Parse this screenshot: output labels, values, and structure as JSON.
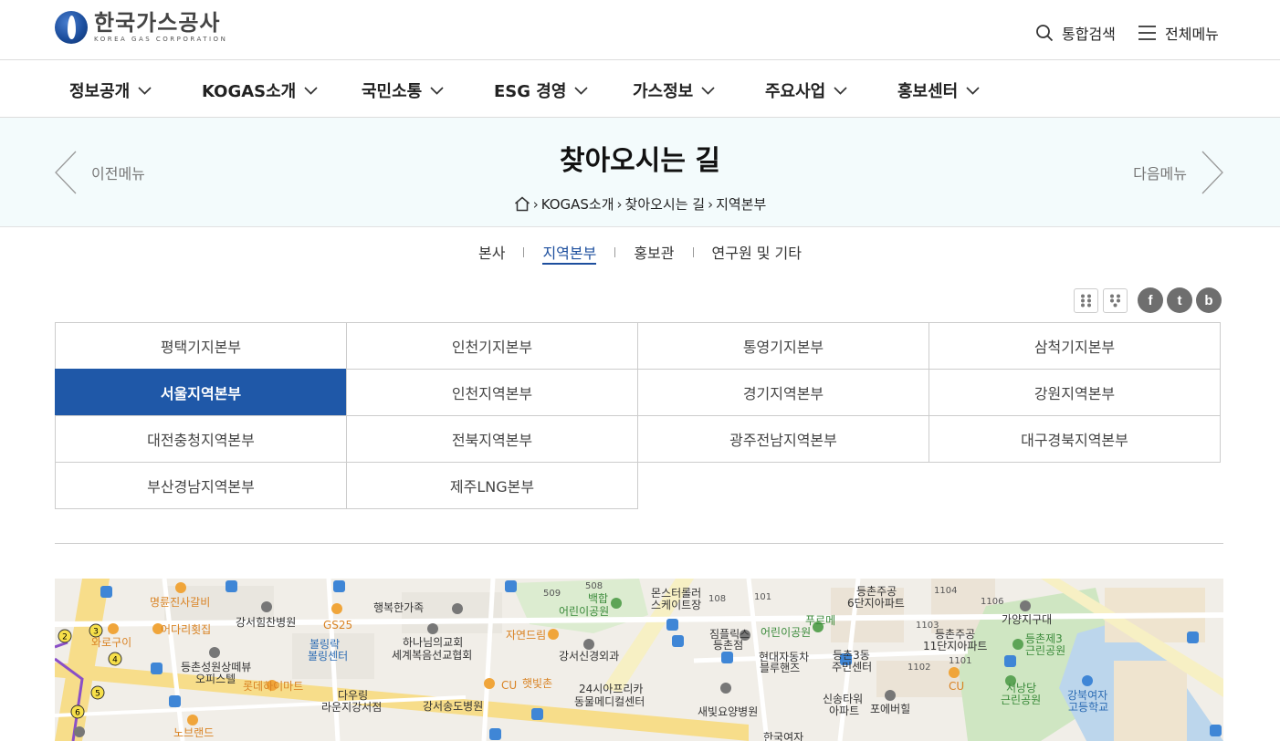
{
  "header": {
    "logo_ko": "한국가스공사",
    "logo_en": "KOREA GAS CORPORATION",
    "search_label": "통합검색",
    "menu_label": "전체메뉴"
  },
  "gnb": [
    {
      "label": "정보공개"
    },
    {
      "label": "KOGAS소개"
    },
    {
      "label": "국민소통"
    },
    {
      "label": "ESG 경영"
    },
    {
      "label": "가스정보"
    },
    {
      "label": "주요사업"
    },
    {
      "label": "홍보센터"
    }
  ],
  "subvisual": {
    "title": "찾아오시는 길",
    "prev_label": "이전메뉴",
    "next_label": "다음메뉴",
    "breadcrumb": [
      "KOGAS소개",
      "찾아오시는 길",
      "지역본부"
    ]
  },
  "subtabs": [
    {
      "label": "본사",
      "active": false
    },
    {
      "label": "지역본부",
      "active": true
    },
    {
      "label": "홍보관",
      "active": false
    },
    {
      "label": "연구원 및 기타",
      "active": false
    }
  ],
  "regions": [
    {
      "label": "평택기지본부",
      "active": false
    },
    {
      "label": "인천기지본부",
      "active": false
    },
    {
      "label": "통영기지본부",
      "active": false
    },
    {
      "label": "삼척기지본부",
      "active": false
    },
    {
      "label": "서울지역본부",
      "active": true
    },
    {
      "label": "인천지역본부",
      "active": false
    },
    {
      "label": "경기지역본부",
      "active": false
    },
    {
      "label": "강원지역본부",
      "active": false
    },
    {
      "label": "대전충청지역본부",
      "active": false
    },
    {
      "label": "전북지역본부",
      "active": false
    },
    {
      "label": "광주전남지역본부",
      "active": false
    },
    {
      "label": "대구경북지역본부",
      "active": false
    },
    {
      "label": "부산경남지역본부",
      "active": false
    },
    {
      "label": "제주LNG본부",
      "active": false
    }
  ],
  "sns": {
    "facebook": "f",
    "twitter": "t",
    "blog": "b"
  },
  "map_labels": [
    {
      "text": "명륜진사갈비",
      "style": "orange"
    },
    {
      "text": "강서힘찬병원",
      "style": ""
    },
    {
      "text": "GS25",
      "style": "orange"
    },
    {
      "text": "행복한가족",
      "style": ""
    },
    {
      "text": "어다리횟집",
      "style": "orange"
    },
    {
      "text": "와로구이",
      "style": "orange"
    },
    {
      "text": "하나님의교회",
      "style": ""
    },
    {
      "text": "세계복음선교협회",
      "style": ""
    },
    {
      "text": "볼링락",
      "style": "blue"
    },
    {
      "text": "볼링센터",
      "style": "blue"
    },
    {
      "text": "등촌성원상떼뷰",
      "style": ""
    },
    {
      "text": "오피스텔",
      "style": ""
    },
    {
      "text": "롯데하이마트",
      "style": "orange"
    },
    {
      "text": "다우링",
      "style": ""
    },
    {
      "text": "라운지강서점",
      "style": ""
    },
    {
      "text": "강서송도병원",
      "style": ""
    },
    {
      "text": "자연드림",
      "style": "orange"
    },
    {
      "text": "강서신경외과",
      "style": ""
    },
    {
      "text": "CU",
      "style": "orange"
    },
    {
      "text": "햇빛촌",
      "style": "orange"
    },
    {
      "text": "24시아프리카",
      "style": ""
    },
    {
      "text": "동물메디컬센터",
      "style": ""
    },
    {
      "text": "508",
      "style": "small"
    },
    {
      "text": "509",
      "style": "small"
    },
    {
      "text": "백합",
      "style": "green"
    },
    {
      "text": "어린이공원",
      "style": "green"
    },
    {
      "text": "몬스터롤러",
      "style": ""
    },
    {
      "text": "스케이트장",
      "style": ""
    },
    {
      "text": "108",
      "style": "small"
    },
    {
      "text": "101",
      "style": "small"
    },
    {
      "text": "짐플릭스",
      "style": ""
    },
    {
      "text": "등촌점",
      "style": ""
    },
    {
      "text": "푸르메",
      "style": "green"
    },
    {
      "text": "어린이공원",
      "style": "green"
    },
    {
      "text": "현대자동차",
      "style": ""
    },
    {
      "text": "블루핸즈",
      "style": ""
    },
    {
      "text": "새빛요양병원",
      "style": ""
    },
    {
      "text": "등촌주공",
      "style": ""
    },
    {
      "text": "6단지아파트",
      "style": ""
    },
    {
      "text": "등촌3동",
      "style": ""
    },
    {
      "text": "주민센터",
      "style": ""
    },
    {
      "text": "1104",
      "style": "small"
    },
    {
      "text": "1103",
      "style": "small"
    },
    {
      "text": "등촌주공",
      "style": ""
    },
    {
      "text": "11단지아파트",
      "style": ""
    },
    {
      "text": "1101",
      "style": "small"
    },
    {
      "text": "1102",
      "style": "small"
    },
    {
      "text": "CU",
      "style": "orange"
    },
    {
      "text": "신송타워",
      "style": ""
    },
    {
      "text": "아파트",
      "style": ""
    },
    {
      "text": "포에버힐",
      "style": ""
    },
    {
      "text": "1106",
      "style": "small"
    },
    {
      "text": "가양지구대",
      "style": ""
    },
    {
      "text": "등촌제3",
      "style": "green"
    },
    {
      "text": "근린공원",
      "style": "green"
    },
    {
      "text": "서낭당",
      "style": "green"
    },
    {
      "text": "근린공원",
      "style": "green"
    },
    {
      "text": "강북여자",
      "style": "blue"
    },
    {
      "text": "고등학교",
      "style": "blue"
    },
    {
      "text": "노브랜드",
      "style": "orange"
    },
    {
      "text": "한국여자",
      "style": ""
    }
  ]
}
